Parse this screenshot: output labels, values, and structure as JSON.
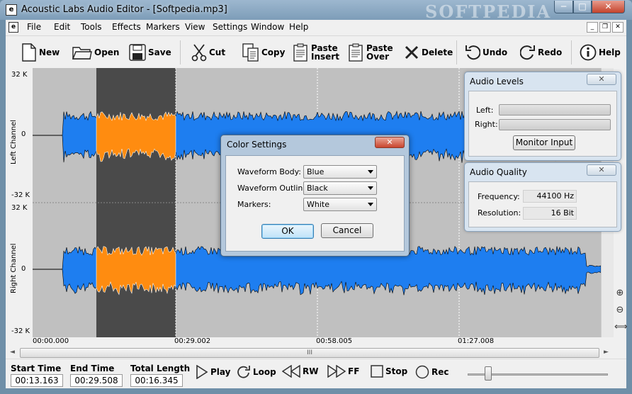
{
  "window": {
    "title": "Acoustic Labs Audio Editor - [Softpedia.mp3]",
    "watermark": "SOFTPEDIA",
    "min_glyph": "─",
    "max_glyph": "□",
    "close_glyph": "✕"
  },
  "menu": {
    "items": [
      "File",
      "Edit",
      "Tools",
      "Effects",
      "Markers",
      "View",
      "Settings",
      "Window",
      "Help"
    ],
    "doc_icon": "e",
    "mdi_min": "_",
    "mdi_restore": "❐",
    "mdi_close": "✕"
  },
  "toolbar": {
    "new": "New",
    "open": "Open",
    "save": "Save",
    "cut": "Cut",
    "copy": "Copy",
    "paste_insert_1": "Paste",
    "paste_insert_2": "Insert",
    "paste_over_1": "Paste",
    "paste_over_2": "Over",
    "delete": "Delete",
    "undo": "Undo",
    "redo": "Redo",
    "help": "Help"
  },
  "ruler": {
    "top": "32 K",
    "mid": "0",
    "bottom": "-32 K",
    "left_channel": "Left Channel",
    "right_channel": "Right Channel"
  },
  "timeline": [
    "00:00.000",
    "00:29.002",
    "00:58.005",
    "01:27.008"
  ],
  "colors": {
    "waveform": "#1e7ef0",
    "selection_wave": "#ff8c10",
    "selection_bg": "#4a4a4a",
    "track_bg": "#c0c0c0"
  },
  "audio_levels": {
    "title": "Audio Levels",
    "close": "✕",
    "left": "Left:",
    "right": "Right:",
    "monitor": "Monitor Input"
  },
  "audio_quality": {
    "title": "Audio Quality",
    "close": "✕",
    "frequency_label": "Frequency:",
    "frequency": "44100 Hz",
    "resolution_label": "Resolution:",
    "resolution": "16 Bit"
  },
  "dialog": {
    "title": "Color Settings",
    "close": "✕",
    "body_label": "Waveform Body:",
    "body_value": "Blue",
    "outline_label": "Waveform Outline:",
    "outline_value": "Black",
    "markers_label": "Markers:",
    "markers_value": "White",
    "ok": "OK",
    "cancel": "Cancel"
  },
  "hscroll": {
    "grip": "III",
    "left": "◄",
    "right": "►"
  },
  "zoom": {
    "in": "⊕",
    "out": "⊖",
    "fit": "⟺"
  },
  "transport": {
    "start_label": "Start Time",
    "start": "00:13.163",
    "end_label": "End Time",
    "end": "00:29.508",
    "length_label": "Total Length",
    "length": "00:16.345",
    "play": "Play",
    "loop": "Loop",
    "rw": "RW",
    "ff": "FF",
    "stop": "Stop",
    "rec": "Rec"
  }
}
